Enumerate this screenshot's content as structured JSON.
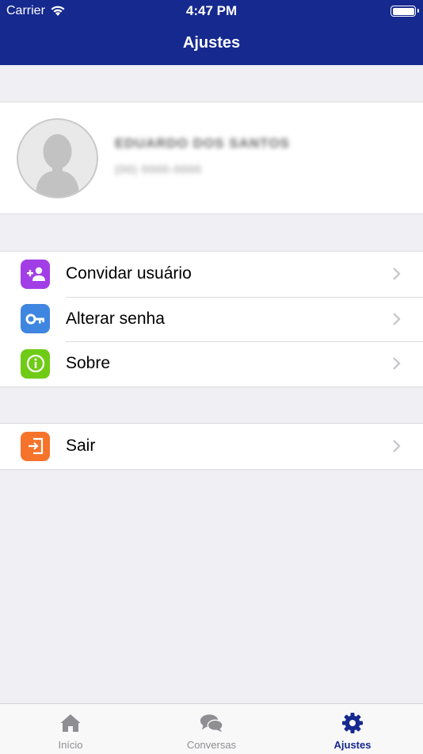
{
  "status_bar": {
    "carrier": "Carrier",
    "time": "4:47 PM"
  },
  "nav": {
    "title": "Ajustes"
  },
  "profile": {
    "name": "EDUARDO DOS SANTOS",
    "subtitle": "(00) 0000-0000"
  },
  "menu": [
    {
      "label": "Convidar usuário",
      "icon": "add-user-icon",
      "color": "#a23ee6"
    },
    {
      "label": "Alterar senha",
      "icon": "key-icon",
      "color": "#3f86e0"
    },
    {
      "label": "Sobre",
      "icon": "info-icon",
      "color": "#6fcb16"
    }
  ],
  "logout": {
    "label": "Sair",
    "icon": "exit-icon",
    "color": "#f5732b"
  },
  "tabbar": {
    "items": [
      {
        "label": "Início",
        "icon": "home-icon",
        "active": false
      },
      {
        "label": "Conversas",
        "icon": "chat-icon",
        "active": false
      },
      {
        "label": "Ajustes",
        "icon": "gear-icon",
        "active": true
      }
    ]
  },
  "colors": {
    "brand": "#16298f",
    "background": "#efeff4",
    "inactive_tab": "#8e8e93"
  }
}
